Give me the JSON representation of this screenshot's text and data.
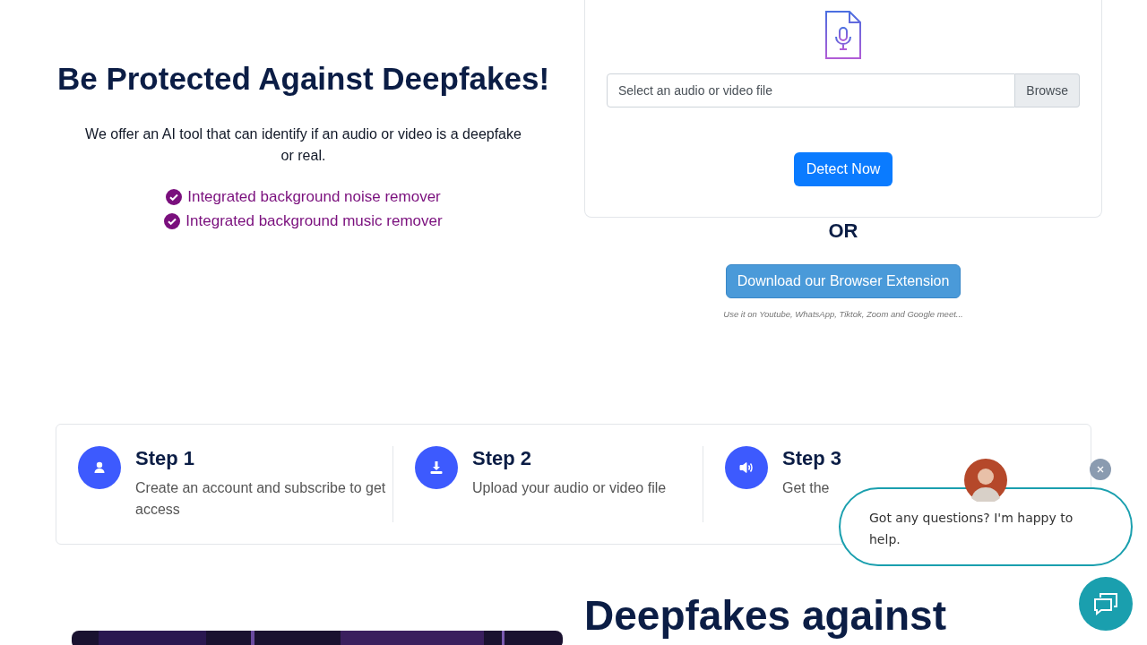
{
  "hero": {
    "title": "Be Protected Against Deepfakes!",
    "description": "We offer an AI tool that can identify if an audio or video is a deepfake or real.",
    "features": [
      "Integrated background noise remover",
      "Integrated background music remover"
    ]
  },
  "upload": {
    "placeholder": "Select an audio or video file",
    "browse": "Browse",
    "detect": "Detect Now"
  },
  "or": "OR",
  "extension": {
    "button": "Download our Browser Extension",
    "note": "Use it on Youtube, WhatsApp, Tiktok, Zoom and Google meet..."
  },
  "steps": [
    {
      "kind": "user",
      "title": "Step 1",
      "text": "Create an account and subscribe to get access"
    },
    {
      "kind": "download",
      "title": "Step 2",
      "text": "Upload your audio or video file"
    },
    {
      "kind": "sound",
      "title": "Step 3",
      "text": "Get the"
    }
  ],
  "chat": {
    "message": "Got any questions? I'm happy to help."
  },
  "section": {
    "title": "Deepfakes against"
  }
}
